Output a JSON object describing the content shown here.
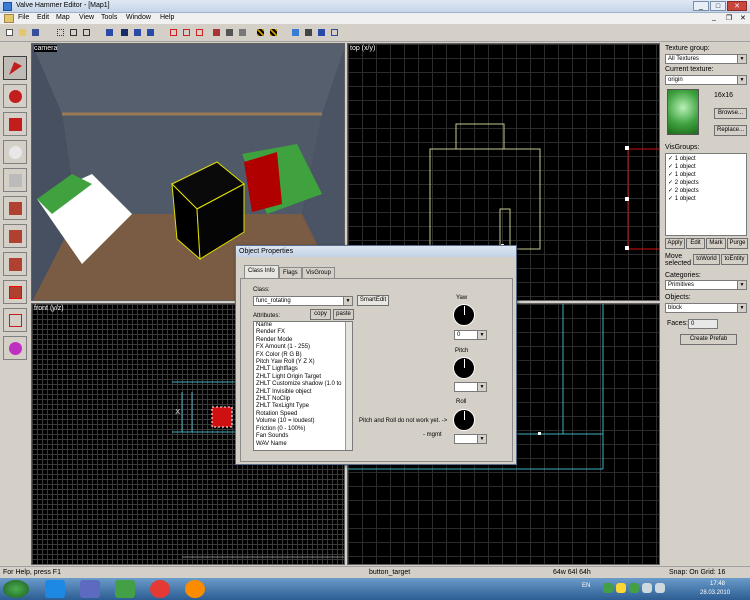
{
  "window": {
    "title": "Valve Hammer Editor - [Map1]",
    "minimize": "_",
    "maximize": "□",
    "close": "✕"
  },
  "menu": [
    "File",
    "Edit",
    "Map",
    "View",
    "Tools",
    "Window",
    "Help"
  ],
  "viewports": {
    "camera": "camera",
    "top": "top (x/y)",
    "front": "front (y/z)",
    "side": ""
  },
  "right_panel": {
    "texture_group_label": "Texture group:",
    "texture_group_value": "All Textures",
    "current_texture_label": "Current texture:",
    "current_texture_value": "origin",
    "texture_size": "16x16",
    "browse": "Browse...",
    "replace": "Replace...",
    "visgroups_label": "VisGroups:",
    "visgroups": [
      "1 object",
      "1 object",
      "1 object",
      "2 objects",
      "2 objects",
      "1 object"
    ],
    "apply": "Apply",
    "edit": "Edit",
    "mark": "Mark",
    "purge": "Purge",
    "move_selected": "Move selected",
    "to_world": "toWorld",
    "to_entity": "toEntity",
    "categories_label": "Categories:",
    "categories_value": "Primitives",
    "objects_label": "Objects:",
    "objects_value": "block",
    "faces_label": "Faces:",
    "faces_value": "0",
    "create_prefab": "Create Prefab"
  },
  "dialog": {
    "title": "Object Properties",
    "tabs": [
      "Class Info",
      "Flags",
      "VisGroup"
    ],
    "class_label": "Class:",
    "class_value": "func_rotating",
    "smartedit": "SmartEdit",
    "attributes_label": "Attributes:",
    "copy": "copy",
    "paste": "paste",
    "attributes": [
      "Name",
      "Render FX",
      "Render Mode",
      "FX Amount (1 - 255)",
      "FX Color (R G B)",
      "Pitch Yaw Roll (Y Z X)",
      "ZHLT Lightflags",
      "ZHLT Light Origin Target",
      "ZHLT Customize shadow (1.0 to",
      "ZHLT Invisible object",
      "ZHLT NoClip",
      "ZHLT TexLight Type",
      "Rotation Speed",
      "Volume (10 = loudest)",
      "Friction (0 - 100%)",
      "Fan Sounds",
      "WAV Name"
    ],
    "yaw_label": "Yaw",
    "yaw_value": "0",
    "pitch_label": "Pitch",
    "roll_label": "Roll",
    "note": "Pitch and Roll do not work yet. ->",
    "note_sig": "- mgmt"
  },
  "status": {
    "help": "For Help, press F1",
    "selection": "button_target",
    "size": "64w 64l 64h",
    "snap": "Snap: On Grid: 16"
  },
  "taskbar": {
    "lang": "EN",
    "time": "17:48",
    "date": "28.03.2010"
  },
  "colors": {
    "accent": "#3a7bd5",
    "grid_line": "#c8c890",
    "selection": "#d01010"
  }
}
